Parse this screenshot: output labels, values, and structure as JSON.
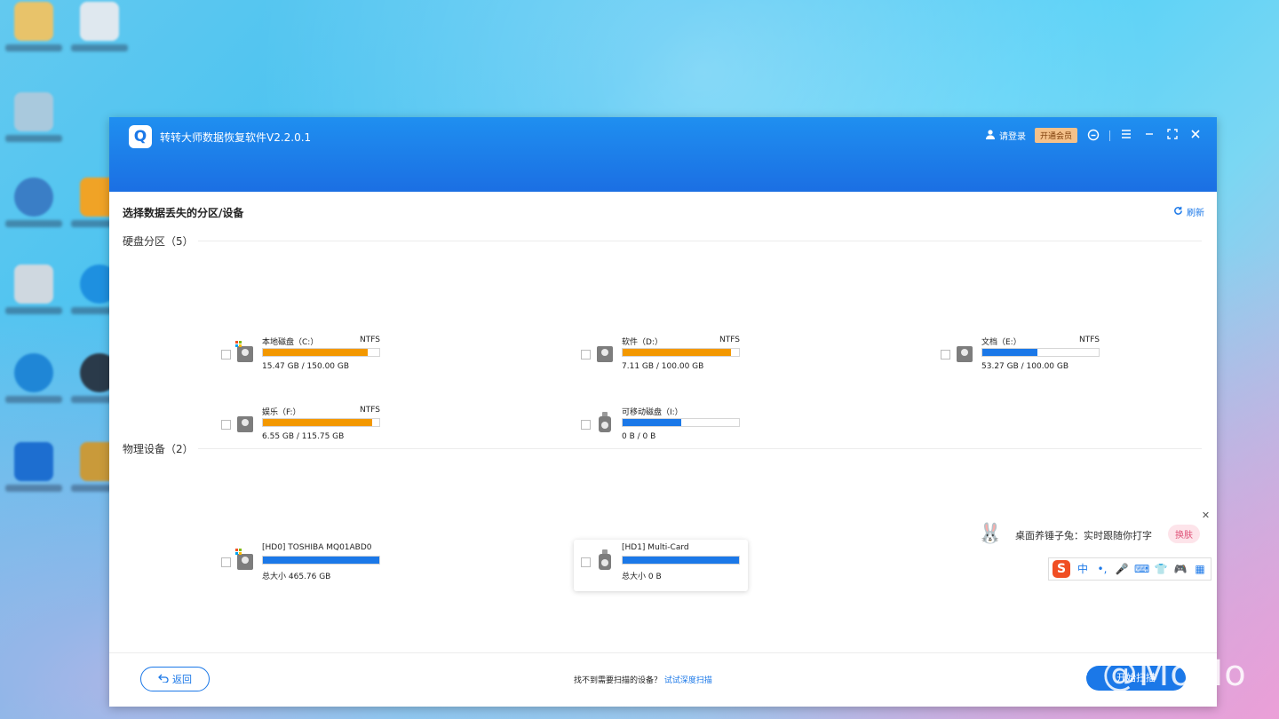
{
  "app": {
    "title": "转转大师数据恢复软件V2.2.0.1",
    "logo_glyph": "Q",
    "login_label": "请登录",
    "vip_label": "开通会员"
  },
  "content": {
    "heading": "选择数据丢失的分区/设备",
    "refresh_label": "刷新",
    "partitions_heading": "硬盘分区（5）",
    "devices_heading": "物理设备（2）",
    "partitions": [
      {
        "name": "本地磁盘（C:）",
        "fs": "NTFS",
        "size": "15.47 GB / 150.00 GB",
        "used_ratio": 0.9,
        "color": "#f39800",
        "icon": "windows-disk-icon"
      },
      {
        "name": "软件（D:）",
        "fs": "NTFS",
        "size": "7.11 GB / 100.00 GB",
        "used_ratio": 0.93,
        "color": "#f39800",
        "icon": "disk-icon"
      },
      {
        "name": "文档（E:）",
        "fs": "NTFS",
        "size": "53.27 GB / 100.00 GB",
        "used_ratio": 0.47,
        "color": "#1b78e8",
        "icon": "disk-icon"
      },
      {
        "name": "娱乐（F:）",
        "fs": "NTFS",
        "size": "6.55 GB / 115.75 GB",
        "used_ratio": 0.94,
        "color": "#f39800",
        "icon": "disk-icon"
      },
      {
        "name": "可移动磁盘（I:）",
        "fs": "",
        "size": "0 B / 0 B",
        "used_ratio": 0.5,
        "color": "#1b78e8",
        "icon": "usb-drive-icon"
      }
    ],
    "devices": [
      {
        "name": "[HD0] TOSHIBA MQ01ABD0",
        "size": "总大小 465.76 GB",
        "used_ratio": 1.0,
        "color": "#1b78e8",
        "icon": "windows-disk-icon"
      },
      {
        "name": "[HD1] Multi-Card",
        "size": "总大小 0 B",
        "used_ratio": 1.0,
        "color": "#1b78e8",
        "icon": "usb-drive-icon"
      }
    ]
  },
  "footer": {
    "back_label": "返回",
    "hint_text": "找不到需要扫描的设备？",
    "hint_link": "试试深度扫描",
    "scan_label": "开始扫描"
  },
  "sogou": {
    "tip_text": "桌面养锤子兔：实时跟随你打字",
    "skin_label": "换肤",
    "s_glyph": "S",
    "tools": [
      "中",
      "•,",
      "🎤",
      "⌨",
      "👕",
      "🎮",
      "▦"
    ]
  },
  "watermark": "知乎 @MoMo"
}
